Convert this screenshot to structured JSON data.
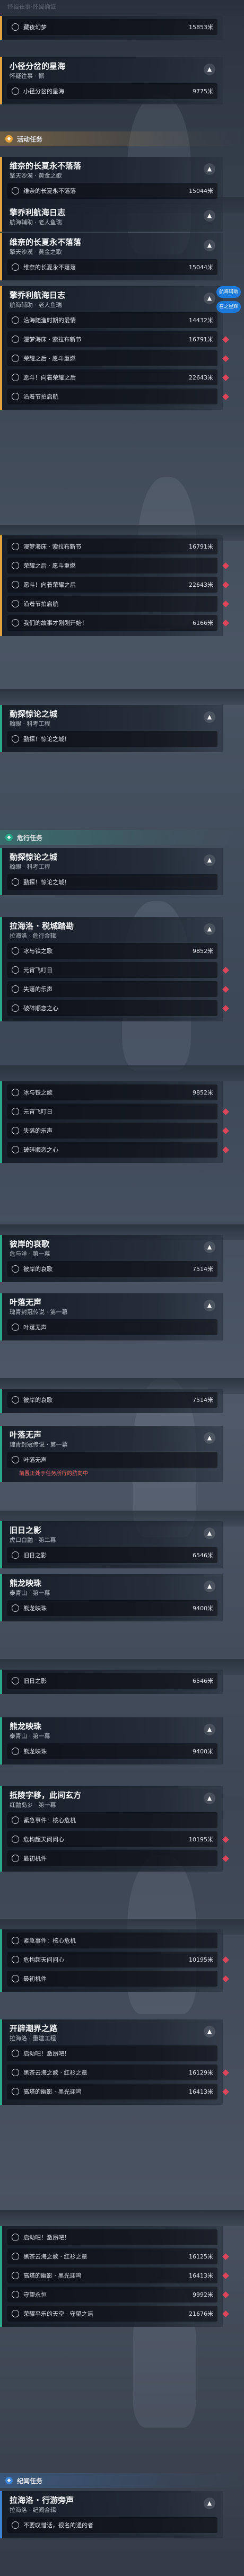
{
  "top": {
    "sub": "怀疑往事·怀疑确证"
  },
  "sections": {
    "activity": "活动任务",
    "main": "危行任务",
    "legend": "纪闻任务"
  },
  "tip": {
    "nav": "航海辅助",
    "call": "召之星辉"
  },
  "cards": [
    {
      "id": "c0",
      "color": "orange",
      "title": "",
      "sub": "",
      "rows": [
        {
          "l": "藏夜幻梦",
          "d": "15853米",
          "done": false
        }
      ]
    },
    {
      "id": "c1",
      "color": "orange",
      "title": "小径分岔的星海",
      "sub": "怀疑往事 · 懈",
      "rows": [
        {
          "l": "小径分岔的星海",
          "d": "9775米",
          "done": false
        }
      ]
    },
    {
      "id": "c2",
      "color": "orange",
      "title": "维奈的长夏永不落落",
      "sub": "擎天沙漠 · 黄金之歌",
      "rows": [
        {
          "l": "维奈的长夏永不落落",
          "d": "15044米",
          "done": false
        }
      ]
    },
    {
      "id": "c3",
      "color": "orange",
      "title": "擎乔利航海日志",
      "sub": "航海辅助 · 老人鱼瑞",
      "rows": []
    },
    {
      "id": "c4",
      "color": "orange",
      "title": "维奈的长夏永不落落",
      "sub": "擎天沙漠 · 黄金之歌",
      "rows": [
        {
          "l": "维奈的长夏永不落落",
          "d": "15044米",
          "done": false
        }
      ]
    },
    {
      "id": "c5",
      "color": "orange",
      "title": "擎乔利航海日志",
      "sub": "航海辅助 · 老人鱼瑞",
      "rows": [
        {
          "l": "沿海随渔时期的爱情",
          "d": "14432米",
          "done": false
        },
        {
          "l": "漫梦海床 · 索拉布新节",
          "d": "16791米",
          "done": false
        },
        {
          "l": "荣耀之后 · 愿斗重燃",
          "d": "",
          "done": false
        },
        {
          "l": "愿斗！向着荣耀之后",
          "d": "22643米",
          "done": false
        },
        {
          "l": "沿着节拍启航",
          "d": "",
          "done": false
        }
      ]
    },
    {
      "id": "c6",
      "color": "orange",
      "title": "",
      "sub": "",
      "rows": [
        {
          "l": "漫梦海床 · 索拉布新节",
          "d": "16791米",
          "done": false
        },
        {
          "l": "荣耀之后 · 愿斗重燃",
          "d": "",
          "done": false
        },
        {
          "l": "愿斗！向着荣耀之后",
          "d": "22643米",
          "done": false
        },
        {
          "l": "沿着节拍启航",
          "d": "",
          "done": false
        },
        {
          "l": "我们的故事才刚刚开始！",
          "d": "6166米",
          "done": false
        }
      ]
    },
    {
      "id": "c7",
      "color": "green",
      "title": "勤探惊论之城",
      "sub": "翰眼 · 科考工程",
      "rows": [
        {
          "l": "勤探！惊论之城！",
          "d": "",
          "done": false
        }
      ]
    },
    {
      "id": "c8",
      "color": "green",
      "title": "勤探惊论之城",
      "sub": "翰眼 · 科考工程",
      "rows": [
        {
          "l": "勤探！惊论之城！",
          "d": "",
          "done": false
        }
      ]
    },
    {
      "id": "c9",
      "color": "green",
      "title": "拉海洛 · 税城踏勘",
      "sub": "拉海洛 · 危行合辑",
      "rows": [
        {
          "l": "冰与铁之歌",
          "d": "9852米",
          "done": false
        },
        {
          "l": "元宵飞叮日",
          "d": "",
          "done": false
        },
        {
          "l": "失落的乐声",
          "d": "",
          "done": false
        },
        {
          "l": "破碎顺恋之心",
          "d": "",
          "done": false
        }
      ]
    },
    {
      "id": "c10",
      "color": "green",
      "title": "",
      "sub": "",
      "rows": [
        {
          "l": "冰与铁之歌",
          "d": "9852米",
          "done": false
        },
        {
          "l": "元宵飞叮日",
          "d": "",
          "done": false
        },
        {
          "l": "失落的乐声",
          "d": "",
          "done": false
        },
        {
          "l": "破碎顺恋之心",
          "d": "",
          "done": false
        }
      ]
    },
    {
      "id": "c11",
      "color": "green",
      "title": "彼岸的哀歌",
      "sub": "危与洋 · 第一幕",
      "rows": [
        {
          "l": "彼岸的哀歌",
          "d": "7514米",
          "done": false
        }
      ]
    },
    {
      "id": "c12",
      "color": "green",
      "title": "叶落无声",
      "sub": "瑰青封冠传说 · 第一幕",
      "rows": [
        {
          "l": "叶落无声",
          "d": "",
          "done": false
        }
      ]
    },
    {
      "id": "c13",
      "color": "green",
      "title": "",
      "sub": "",
      "rows": [
        {
          "l": "彼岸的哀歌",
          "d": "7514米",
          "done": false
        }
      ]
    },
    {
      "id": "c14",
      "color": "green",
      "title": "叶落无声",
      "sub": "瑰青封冠传说 · 第一幕",
      "rows": [
        {
          "l": "叶落无声",
          "d": "",
          "done": false,
          "warn": "前置正处于任务所行的航向中"
        }
      ]
    },
    {
      "id": "c15",
      "color": "green",
      "title": "旧日之影",
      "sub": "虎口白鼬 · 第二幕",
      "rows": [
        {
          "l": "旧日之影",
          "d": "6546米",
          "done": false
        }
      ]
    },
    {
      "id": "c16",
      "color": "green",
      "title": "熊龙映珠",
      "sub": "泰青山 · 第一幕",
      "rows": [
        {
          "l": "熊龙映珠",
          "d": "9400米",
          "done": false
        }
      ]
    },
    {
      "id": "c17",
      "color": "green",
      "title": "",
      "sub": "",
      "rows": [
        {
          "l": "旧日之影",
          "d": "6546米",
          "done": false
        }
      ]
    },
    {
      "id": "c18",
      "color": "green",
      "title": "熊龙映珠",
      "sub": "泰青山 · 第一幕",
      "rows": [
        {
          "l": "熊龙映珠",
          "d": "9400米",
          "done": false
        }
      ]
    },
    {
      "id": "c19",
      "color": "green",
      "title": "抵陵字移，此间玄方",
      "sub": "红鼬岛乡 · 第一幕",
      "rows": [
        {
          "l": "紧急事件：核心危机",
          "d": "",
          "done": false
        },
        {
          "l": "危构超天问问心",
          "d": "10195米",
          "done": false
        },
        {
          "l": "最初机件",
          "d": "",
          "done": false
        }
      ]
    },
    {
      "id": "c20",
      "color": "green",
      "title": "",
      "sub": "",
      "rows": [
        {
          "l": "紧急事件：核心危机",
          "d": "",
          "done": false
        },
        {
          "l": "危构超天问问心",
          "d": "10195米",
          "done": false
        },
        {
          "l": "最初机件",
          "d": "",
          "done": false
        }
      ]
    },
    {
      "id": "c21",
      "color": "green",
      "title": "开辟潮界之路",
      "sub": "拉海洛 · 重建工程",
      "rows": [
        {
          "l": "启动吧！激昂吧！",
          "d": "",
          "done": false
        },
        {
          "l": "黑茶云海之歌 · 红衫之章",
          "d": "16129米",
          "done": false
        },
        {
          "l": "高塔的幽影 · 黑光迎鸣",
          "d": "16413米",
          "done": false
        }
      ]
    },
    {
      "id": "c22",
      "color": "green",
      "title": "",
      "sub": "",
      "rows": [
        {
          "l": "启动吧！激昂吧！",
          "d": "",
          "done": false
        },
        {
          "l": "黑茶云海之歌 · 红衫之章",
          "d": "16125米",
          "done": false
        },
        {
          "l": "高塔的幽影 · 黑光迎鸣",
          "d": "16413米",
          "done": false
        },
        {
          "l": "守望永恒",
          "d": "9992米",
          "done": false
        },
        {
          "l": "荣耀平乐的天空 · 守望之谣",
          "d": "21676米",
          "done": false
        }
      ]
    },
    {
      "id": "c23",
      "color": "blue",
      "title": "拉海洛 · 行游旁声",
      "sub": "拉海洛 · 纪闻合辑",
      "rows": [
        {
          "l": "不要叹惜话，很名的通的者",
          "d": "",
          "done": false
        }
      ]
    }
  ]
}
